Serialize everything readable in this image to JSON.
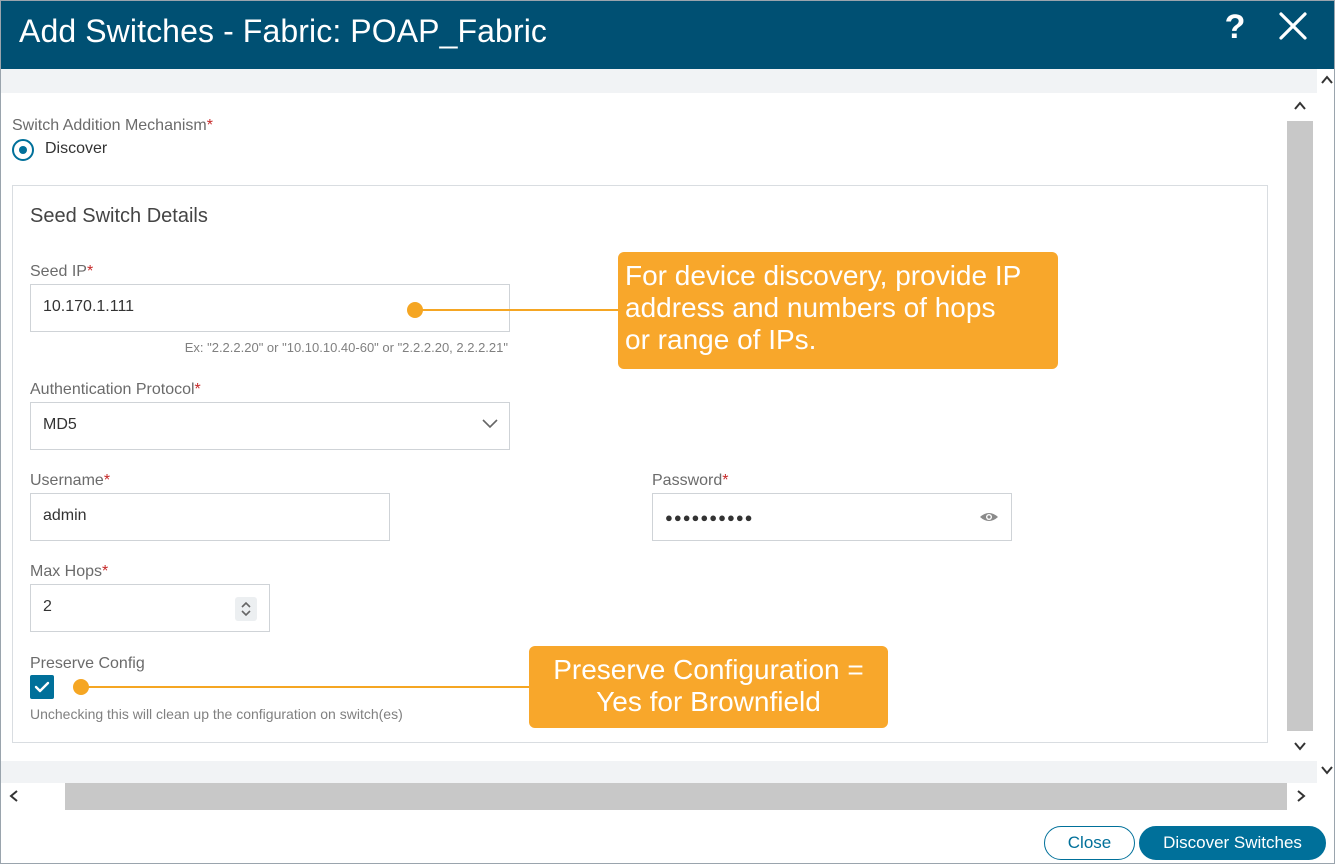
{
  "dialog": {
    "title": "Add Switches - Fabric: POAP_Fabric",
    "help_glyph": "?",
    "help_icon": "question-icon",
    "close_icon": "close-icon"
  },
  "mechanism": {
    "label": "Switch Addition Mechanism",
    "required_mark": "*",
    "option": "Discover",
    "selected": true
  },
  "panel": {
    "title": "Seed Switch Details"
  },
  "seed_ip": {
    "label": "Seed IP",
    "required_mark": "*",
    "value": "10.170.1.111",
    "hint": "Ex: \"2.2.2.20\" or \"10.10.10.40-60\" or \"2.2.2.20, 2.2.2.21\""
  },
  "auth_protocol": {
    "label": "Authentication Protocol",
    "required_mark": "*",
    "value": "MD5"
  },
  "username": {
    "label": "Username",
    "required_mark": "*",
    "value": "admin"
  },
  "password": {
    "label": "Password",
    "required_mark": "*",
    "masked_value": "●●●●●●●●●●",
    "toggle_icon": "eye-icon"
  },
  "max_hops": {
    "label": "Max Hops",
    "required_mark": "*",
    "value": "2"
  },
  "preserve_config": {
    "label": "Preserve Config",
    "checked": true,
    "hint": "Unchecking this will clean up the configuration on switch(es)"
  },
  "callouts": {
    "discovery": [
      "For device discovery, provide IP",
      "address and numbers of hops",
      "or range of IPs."
    ],
    "preserve": [
      "Preserve Configuration =",
      "Yes for Brownfield"
    ]
  },
  "footer": {
    "close_label": "Close",
    "discover_label": "Discover Switches"
  },
  "colors": {
    "header": "#005073",
    "accent": "#00709a",
    "callout": "#f8a72b",
    "required": "#c62828"
  }
}
